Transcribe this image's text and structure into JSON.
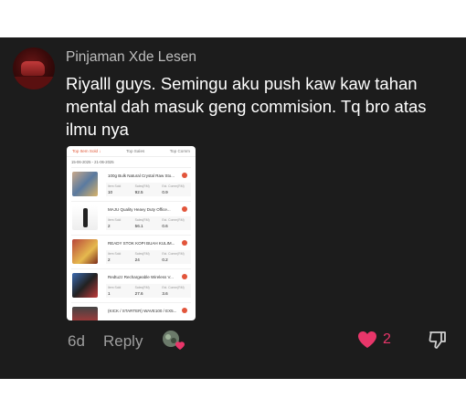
{
  "comment": {
    "username": "Pinjaman Xde Lesen",
    "text": "Riyalll guys. Semingu aku push kaw kaw tahan mental dah masuk geng commision. Tq bro atas ilmu nya",
    "age": "6d",
    "reply_label": "Reply",
    "like_count": "2"
  },
  "attachment": {
    "tabs": [
      "Top Item Sold ↓",
      "Top Sales",
      "Top Comm"
    ],
    "date_range": "15-06-2025 - 21-06-2025",
    "stat_labels": [
      "Item Sold",
      "Sales(RM)",
      "Est. Comm(RM)"
    ],
    "products": [
      {
        "name": "100g Bulk Natural Crystal Raw Sto...",
        "item_sold": "10",
        "sales": "92.5",
        "comm": "0.9"
      },
      {
        "name": "MAJU Quality Heavy Duty Office...",
        "item_sold": "2",
        "sales": "56.1",
        "comm": "0.6"
      },
      {
        "name": "READY STOK KOPI BUAH KULIM...",
        "item_sold": "2",
        "sales": "24",
        "comm": "0.2"
      },
      {
        "name": "Redtuzz Rechargeable Wireless V...",
        "item_sold": "1",
        "sales": "27.6",
        "comm": "3.6"
      },
      {
        "name": "(KICK / STARTER) WAVE100 / EX5..."
      }
    ]
  },
  "colors": {
    "background": "#1c1c1c",
    "like": "#e8366a",
    "accent": "#e05a3a"
  }
}
